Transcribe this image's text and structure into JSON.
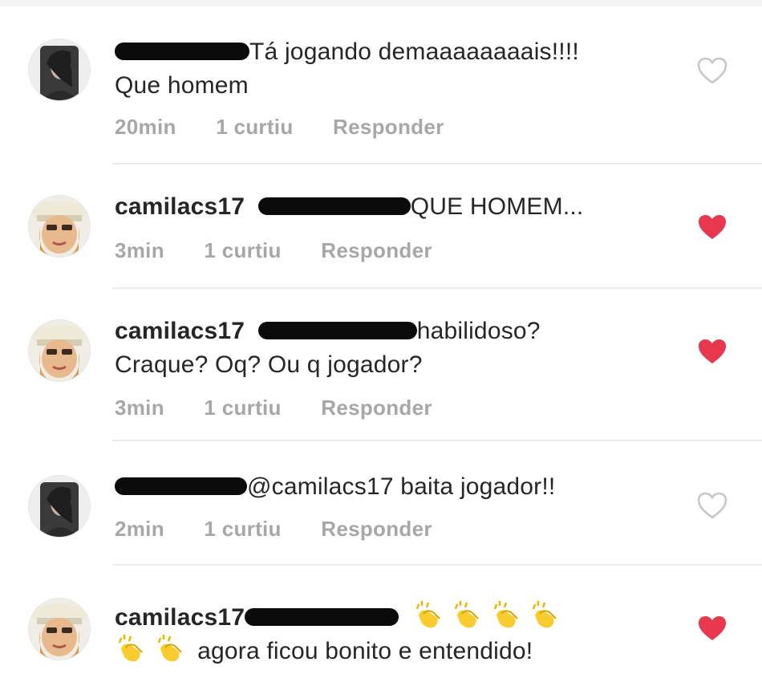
{
  "comments": [
    {
      "username": "",
      "text_line1": "Tá jogando demaaaaaaaais!!!!",
      "text_line2": "Que homem",
      "time": "20min",
      "likes": "1 curtiu",
      "reply": "Responder",
      "liked": false,
      "avatar": "dark-hair-woman"
    },
    {
      "username": "camilacs17",
      "text_line1": "QUE HOMEM...",
      "text_line2": "",
      "time": "3min",
      "likes": "1 curtiu",
      "reply": "Responder",
      "liked": true,
      "avatar": "blonde-hat-woman"
    },
    {
      "username": "camilacs17",
      "text_line1": "habilidoso?",
      "text_line2": "Craque? Oq? Ou q jogador?",
      "time": "3min",
      "likes": "1 curtiu",
      "reply": "Responder",
      "liked": true,
      "avatar": "blonde-hat-woman"
    },
    {
      "username": "",
      "text_line1": "@camilacs17 baita jogador!!",
      "text_line2": "",
      "time": "2min",
      "likes": "1 curtiu",
      "reply": "Responder",
      "liked": false,
      "avatar": "dark-hair-woman"
    },
    {
      "username": "camilacs17",
      "text_line1": "",
      "text_line2": "agora ficou bonito e entendido!",
      "time": "",
      "likes": "",
      "reply": "",
      "liked": true,
      "avatar": "blonde-hat-woman",
      "emoji": "clapping-hands"
    }
  ],
  "colors": {
    "heart_liked": "#e8384f",
    "heart_outline": "#c7c7c7",
    "meta_text": "#a7a7a7",
    "redaction": "#0b0b0b"
  }
}
